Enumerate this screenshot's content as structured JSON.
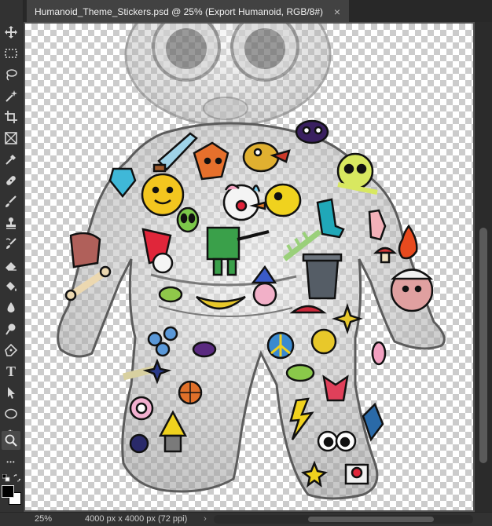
{
  "document": {
    "tab_title": "Humanoid_Theme_Stickers.psd @ 25% (Export Humanoid, RGB/8#)",
    "close_glyph": "×"
  },
  "status": {
    "zoom": "25%",
    "doc_info": "4000 px x 4000 px (72 ppi)",
    "arrow": "›"
  },
  "toolbar": {
    "tools": [
      {
        "name": "move-tool",
        "icon": "move-icon"
      },
      {
        "name": "marquee-tool",
        "icon": "rectangle-marquee-icon"
      },
      {
        "name": "lasso-tool",
        "icon": "lasso-icon"
      },
      {
        "name": "magic-wand-tool",
        "icon": "magic-wand-icon"
      },
      {
        "name": "crop-tool",
        "icon": "crop-icon"
      },
      {
        "name": "frame-tool",
        "icon": "frame-icon"
      },
      {
        "name": "eyedropper-tool",
        "icon": "eyedropper-icon"
      },
      {
        "name": "healing-brush-tool",
        "icon": "bandage-icon"
      },
      {
        "name": "brush-tool",
        "icon": "brush-icon"
      },
      {
        "name": "clone-stamp-tool",
        "icon": "stamp-icon"
      },
      {
        "name": "history-brush-tool",
        "icon": "history-brush-icon"
      },
      {
        "name": "eraser-tool",
        "icon": "eraser-icon"
      },
      {
        "name": "paint-bucket-tool",
        "icon": "paint-bucket-icon"
      },
      {
        "name": "blur-tool",
        "icon": "blur-drop-icon"
      },
      {
        "name": "dodge-tool",
        "icon": "dodge-icon"
      },
      {
        "name": "pen-tool",
        "icon": "pen-icon"
      },
      {
        "name": "type-tool",
        "icon": "type-icon",
        "glyph": "T"
      },
      {
        "name": "path-selection-tool",
        "icon": "arrow-select-icon"
      },
      {
        "name": "ellipse-tool",
        "icon": "ellipse-icon"
      },
      {
        "name": "hand-tool",
        "icon": "hand-icon"
      },
      {
        "name": "zoom-tool",
        "icon": "zoom-icon",
        "active": true
      },
      {
        "name": "more-tools",
        "icon": "ellipsis-icon",
        "glyph": "•••"
      }
    ]
  },
  "colors": {
    "foreground": "#000000",
    "background": "#ffffff",
    "ui_dark": "#323232",
    "tab_active": "#424242"
  }
}
